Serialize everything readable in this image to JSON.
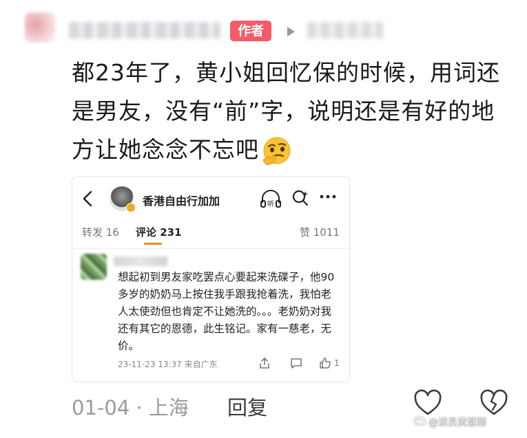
{
  "header": {
    "author_badge": "作者"
  },
  "comment": {
    "text": "都23年了，黄小姐回忆保的时候，用词还是男友，没有“前”字，说明还是有好的地方让她念念不忘吧",
    "emoji": "thinking-face-emoji"
  },
  "embedded_screenshot": {
    "profile_name": "香港自由行加加",
    "listen_icon_label": "听",
    "tabs": [
      {
        "label": "转发 16"
      },
      {
        "label": "评论 231",
        "active": true
      },
      {
        "label": "赞 1011"
      }
    ],
    "reply": {
      "text": "想起初到男友家吃罢点心要起来洗碟子，他90多岁的奶奶马上按住我手跟我抢着洗，我怕老人太使劲但也肯定不让她洗的。。。老奶奶对我还有其它的恩德，此生铭记。家有一慈老，无价。",
      "meta": "23-11-23 13:37 来自广东",
      "like_count": "1"
    }
  },
  "footer": {
    "date_location": "01-04 · 上海",
    "reply_label": "回复",
    "watermark": "@演员黄慧颐"
  },
  "colors": {
    "author_badge": "#f55a68",
    "active_tab_underline": "#f28a1a",
    "verify_badge": "#f5a623"
  }
}
